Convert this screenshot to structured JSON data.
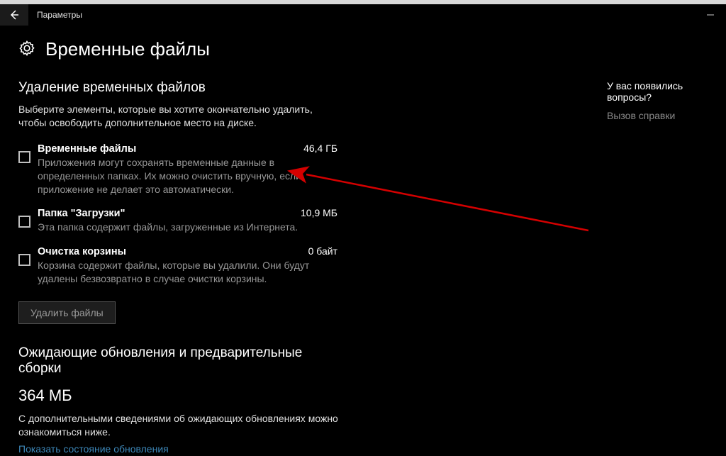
{
  "window": {
    "title": "Параметры"
  },
  "page": {
    "title": "Временные файлы"
  },
  "section1": {
    "title": "Удаление временных файлов",
    "desc": "Выберите элементы, которые вы хотите окончательно удалить, чтобы освободить дополнительное место на диске."
  },
  "items": [
    {
      "title": "Временные файлы",
      "size": "46,4 ГБ",
      "desc": "Приложения могут сохранять временные данные в определенных папках. Их можно очистить вручную, если приложение не делает это автоматически."
    },
    {
      "title": "Папка \"Загрузки\"",
      "size": "10,9 МБ",
      "desc": "Эта папка содержит файлы, загруженные из Интернета."
    },
    {
      "title": "Очистка корзины",
      "size": "0 байт",
      "desc": "Корзина содержит файлы, которые вы удалили. Они будут удалены безвозвратно в случае очистки корзины."
    }
  ],
  "delete_btn": "Удалить файлы",
  "section2": {
    "title": "Ожидающие обновления и предварительные сборки",
    "size": "364 МБ",
    "desc": "С дополнительными сведениями об ожидающих обновлениях можно ознакомиться ниже.",
    "link": "Показать состояние обновления"
  },
  "sidebar": {
    "heading": "У вас появились вопросы?",
    "help_link": "Вызов справки"
  }
}
